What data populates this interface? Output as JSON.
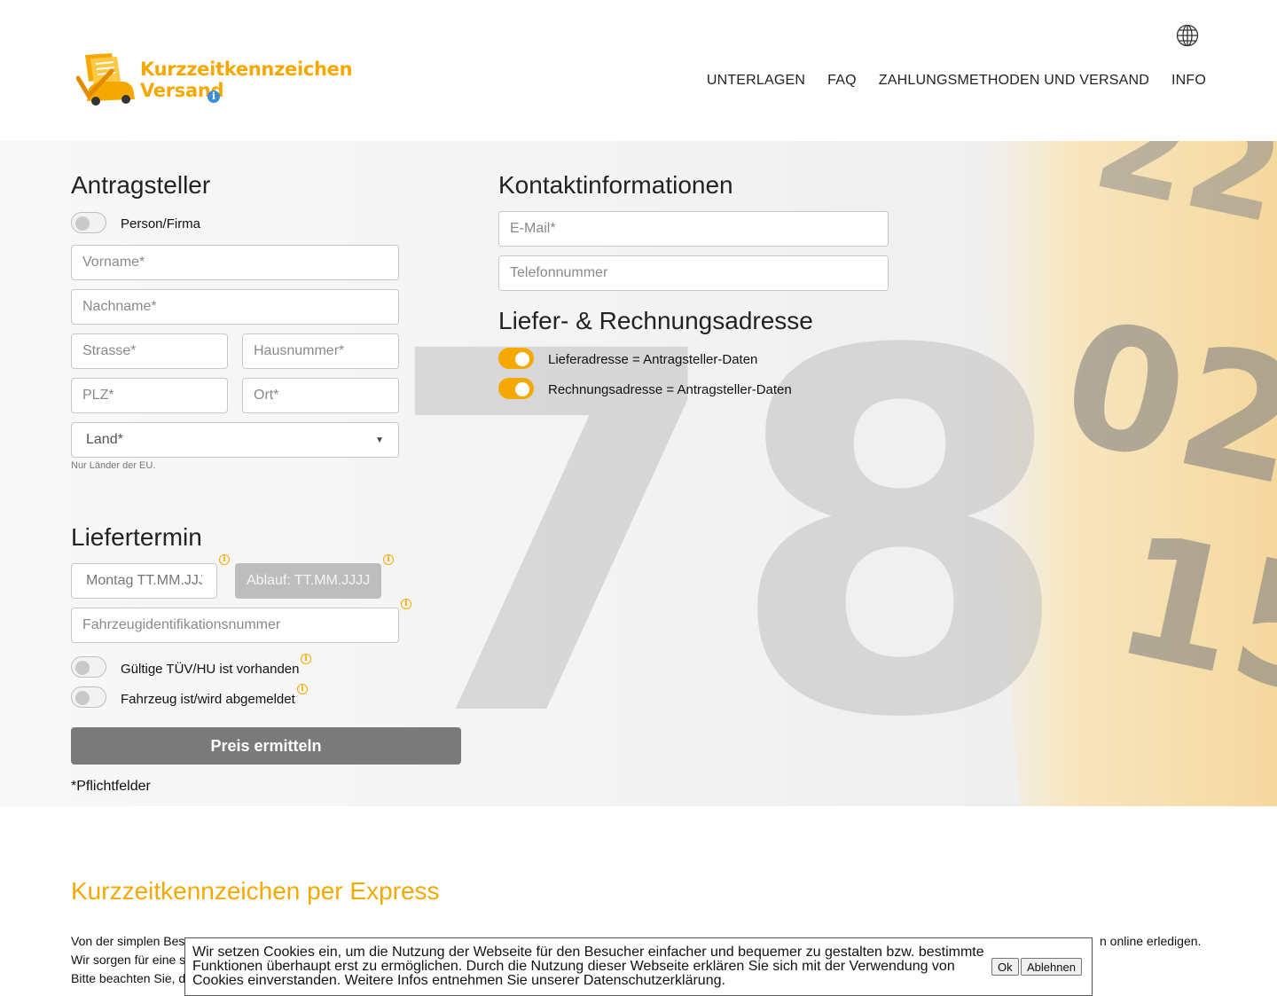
{
  "header": {
    "logo_line1": "Kurzzeitkennzeichen",
    "logo_line2": "Versand",
    "logo_info": "i",
    "nav": [
      "UNTERLAGEN",
      "FAQ",
      "ZAHLUNGSMETHODEN UND VERSAND",
      "INFO"
    ]
  },
  "antragsteller": {
    "title": "Antragsteller",
    "toggle_label": "Person/Firma",
    "vorname_placeholder": "Vorname*",
    "nachname_placeholder": "Nachname*",
    "strasse_placeholder": "Strasse*",
    "hausnummer_placeholder": "Hausnummer*",
    "plz_placeholder": "PLZ*",
    "ort_placeholder": "Ort*",
    "land_value": "Land*",
    "land_hint": "Nur Länder der EU."
  },
  "kontakt": {
    "title": "Kontaktinformationen",
    "email_placeholder": "E-Mail*",
    "telefon_placeholder": "Telefonnummer"
  },
  "adresse": {
    "title": "Liefer- & Rechnungsadresse",
    "lieferadresse_label": "Lieferadresse = Antragsteller-Daten",
    "rechnungsadresse_label": "Rechnungsadresse = Antragsteller-Daten"
  },
  "liefertermin": {
    "title": "Liefertermin",
    "date_value": "Montag TT.MM.JJJJ",
    "ablauf_value": "Ablauf: TT.MM.JJJJ",
    "fin_placeholder": "Fahrzeugidentifikationsnummer",
    "tuev_label": "Gültige TÜV/HU ist vorhanden",
    "abgemeldet_label": "Fahrzeug ist/wird abgemeldet",
    "info_glyph": "i"
  },
  "preis_button": "Preis ermitteln",
  "pflichtfelder": "*Pflichtfelder",
  "express": {
    "title": "Kurzzeitkennzeichen per Express",
    "line1_start": "Von der simplen Bes",
    "line1_end": "n online erledigen.",
    "line2_start": "Wir sorgen für eine s",
    "line3_start": "Bitte beachten Sie, d"
  },
  "cookie": {
    "text": "Wir setzen Cookies ein, um die Nutzung der Webseite für den Besucher einfacher und bequemer zu gestalten bzw. bestimmte Funktionen überhaupt erst zu ermöglichen. Durch die Nutzung dieser Webseite erklären Sie sich mit der Verwendung von Cookies einverstanden. Weitere Infos entnehmen Sie unserer Datenschutzerklärung.",
    "ok": "Ok",
    "ablehnen": "Ablehnen"
  },
  "colors": {
    "accent": "#f5a800",
    "button_gray": "#7a7a7a",
    "logo_info_blue": "#3a8fd9"
  },
  "icons": [
    "logo-icon",
    "globe-icon",
    "info-icon",
    "chevron-down-icon"
  ],
  "background_plate_text": [
    "78",
    "22",
    "02",
    "15"
  ]
}
